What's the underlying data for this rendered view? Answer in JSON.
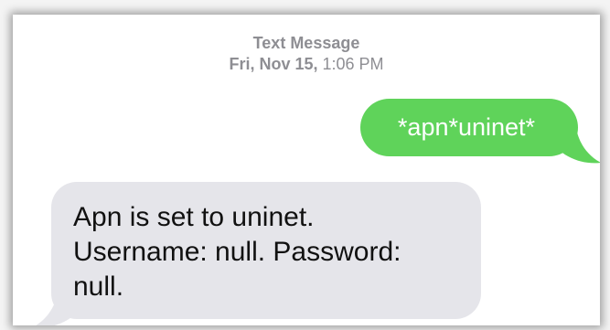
{
  "conversation": {
    "header": {
      "title": "Text Message",
      "date": "Fri, Nov 15,",
      "time": "1:06 PM"
    },
    "messages": [
      {
        "direction": "outgoing",
        "lines": [
          "*apn*uninet*"
        ]
      },
      {
        "direction": "incoming",
        "lines": [
          "Apn is set to uninet.",
          "Username: null. Password:",
          "null."
        ]
      }
    ]
  },
  "colors": {
    "outgoing_bubble": "#5fd35a",
    "incoming_bubble": "#e5e5ea",
    "meta_text": "#8e8e93"
  }
}
